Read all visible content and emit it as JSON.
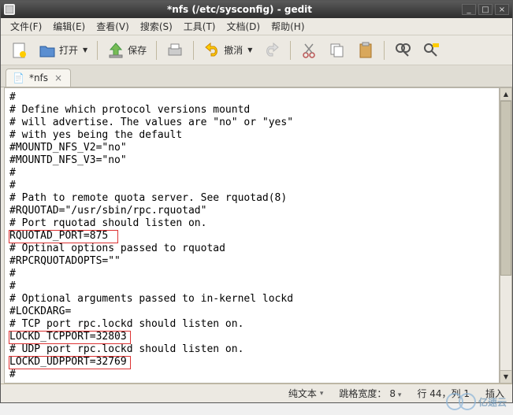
{
  "window": {
    "title": "*nfs (/etc/sysconfig) - gedit"
  },
  "menubar": {
    "file": "文件(F)",
    "edit": "编辑(E)",
    "view": "查看(V)",
    "search": "搜索(S)",
    "tools": "工具(T)",
    "documents": "文档(D)",
    "help": "帮助(H)"
  },
  "toolbar": {
    "open": "打开",
    "save": "保存",
    "undo": "撤消"
  },
  "tab": {
    "icon": "📄",
    "name": "*nfs"
  },
  "editor_lines": [
    "#",
    "# Define which protocol versions mountd",
    "# will advertise. The values are \"no\" or \"yes\"",
    "# with yes being the default",
    "#MOUNTD_NFS_V2=\"no\"",
    "#MOUNTD_NFS_V3=\"no\"",
    "#",
    "#",
    "# Path to remote quota server. See rquotad(8)",
    "#RQUOTAD=\"/usr/sbin/rpc.rquotad\"",
    "# Port rquotad should listen on.",
    "RQUOTAD_PORT=875",
    "# Optinal options passed to rquotad",
    "#RPCRQUOTADOPTS=\"\"",
    "#",
    "#",
    "# Optional arguments passed to in-kernel lockd",
    "#LOCKDARG=",
    "# TCP port rpc.lockd should listen on.",
    "LOCKD_TCPPORT=32803",
    "# UDP port rpc.lockd should listen on.",
    "LOCKD_UDPPORT=32769",
    "#"
  ],
  "status": {
    "syntax": "纯文本",
    "tabwidth_label": "跳格宽度：",
    "tabwidth_value": "8",
    "position": "行 44，列 1",
    "insert": "插入"
  },
  "watermark": "亿速云"
}
